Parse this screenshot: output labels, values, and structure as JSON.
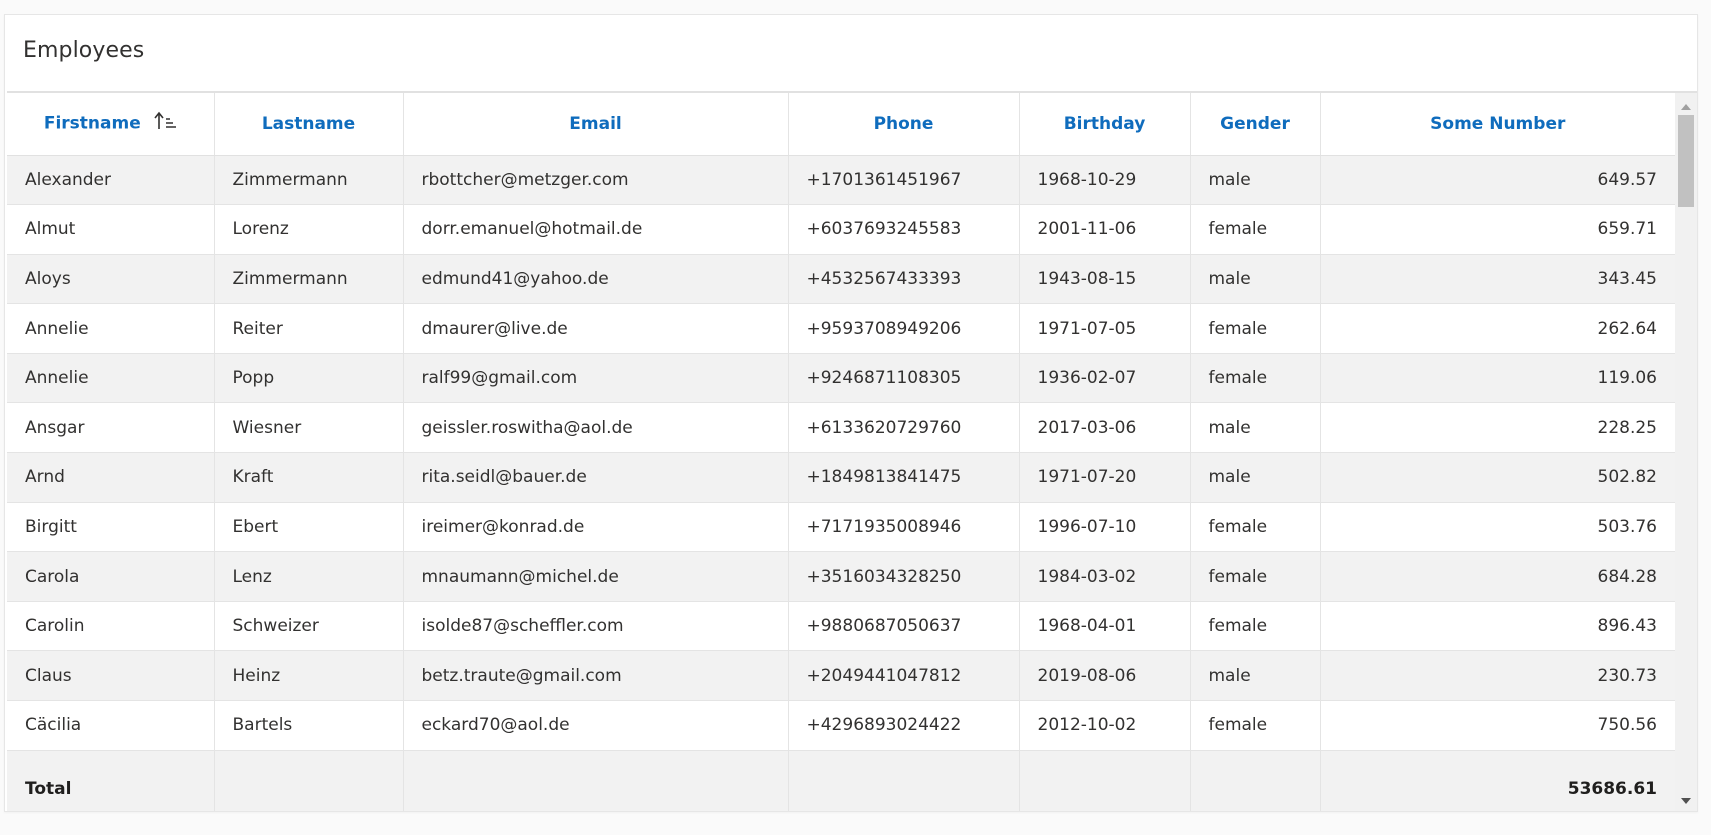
{
  "panel": {
    "title": "Employees"
  },
  "columns": [
    {
      "label": "Firstname",
      "sorted": "ascending"
    },
    {
      "label": "Lastname"
    },
    {
      "label": "Email"
    },
    {
      "label": "Phone"
    },
    {
      "label": "Birthday"
    },
    {
      "label": "Gender"
    },
    {
      "label": "Some Number"
    }
  ],
  "rows": [
    {
      "firstname": "Alexander",
      "lastname": "Zimmermann",
      "email": "rbottcher@metzger.com",
      "phone": "+1701361451967",
      "birthday": "1968-10-29",
      "gender": "male",
      "number": "649.57"
    },
    {
      "firstname": "Almut",
      "lastname": "Lorenz",
      "email": "dorr.emanuel@hotmail.de",
      "phone": "+6037693245583",
      "birthday": "2001-11-06",
      "gender": "female",
      "number": "659.71"
    },
    {
      "firstname": "Aloys",
      "lastname": "Zimmermann",
      "email": "edmund41@yahoo.de",
      "phone": "+4532567433393",
      "birthday": "1943-08-15",
      "gender": "male",
      "number": "343.45"
    },
    {
      "firstname": "Annelie",
      "lastname": "Reiter",
      "email": "dmaurer@live.de",
      "phone": "+9593708949206",
      "birthday": "1971-07-05",
      "gender": "female",
      "number": "262.64"
    },
    {
      "firstname": "Annelie",
      "lastname": "Popp",
      "email": "ralf99@gmail.com",
      "phone": "+9246871108305",
      "birthday": "1936-02-07",
      "gender": "female",
      "number": "119.06"
    },
    {
      "firstname": "Ansgar",
      "lastname": "Wiesner",
      "email": "geissler.roswitha@aol.de",
      "phone": "+6133620729760",
      "birthday": "2017-03-06",
      "gender": "male",
      "number": "228.25"
    },
    {
      "firstname": "Arnd",
      "lastname": "Kraft",
      "email": "rita.seidl@bauer.de",
      "phone": "+1849813841475",
      "birthday": "1971-07-20",
      "gender": "male",
      "number": "502.82"
    },
    {
      "firstname": "Birgitt",
      "lastname": "Ebert",
      "email": "ireimer@konrad.de",
      "phone": "+7171935008946",
      "birthday": "1996-07-10",
      "gender": "female",
      "number": "503.76"
    },
    {
      "firstname": "Carola",
      "lastname": "Lenz",
      "email": "mnaumann@michel.de",
      "phone": "+3516034328250",
      "birthday": "1984-03-02",
      "gender": "female",
      "number": "684.28"
    },
    {
      "firstname": "Carolin",
      "lastname": "Schweizer",
      "email": "isolde87@scheffler.com",
      "phone": "+9880687050637",
      "birthday": "1968-04-01",
      "gender": "female",
      "number": "896.43"
    },
    {
      "firstname": "Claus",
      "lastname": "Heinz",
      "email": "betz.traute@gmail.com",
      "phone": "+2049441047812",
      "birthday": "2019-08-06",
      "gender": "male",
      "number": "230.73"
    },
    {
      "firstname": "Cäcilia",
      "lastname": "Bartels",
      "email": "eckard70@aol.de",
      "phone": "+4296893024422",
      "birthday": "2012-10-02",
      "gender": "female",
      "number": "750.56"
    }
  ],
  "footer": {
    "label": "Total",
    "total": "53686.61"
  },
  "icons": {
    "sort": "sort-ascending-icon",
    "scroll_up": "chevron-up-icon",
    "scroll_down": "chevron-down-icon"
  },
  "colors": {
    "header_text": "#0f6cbd",
    "stripe": "#f2f2f2"
  }
}
